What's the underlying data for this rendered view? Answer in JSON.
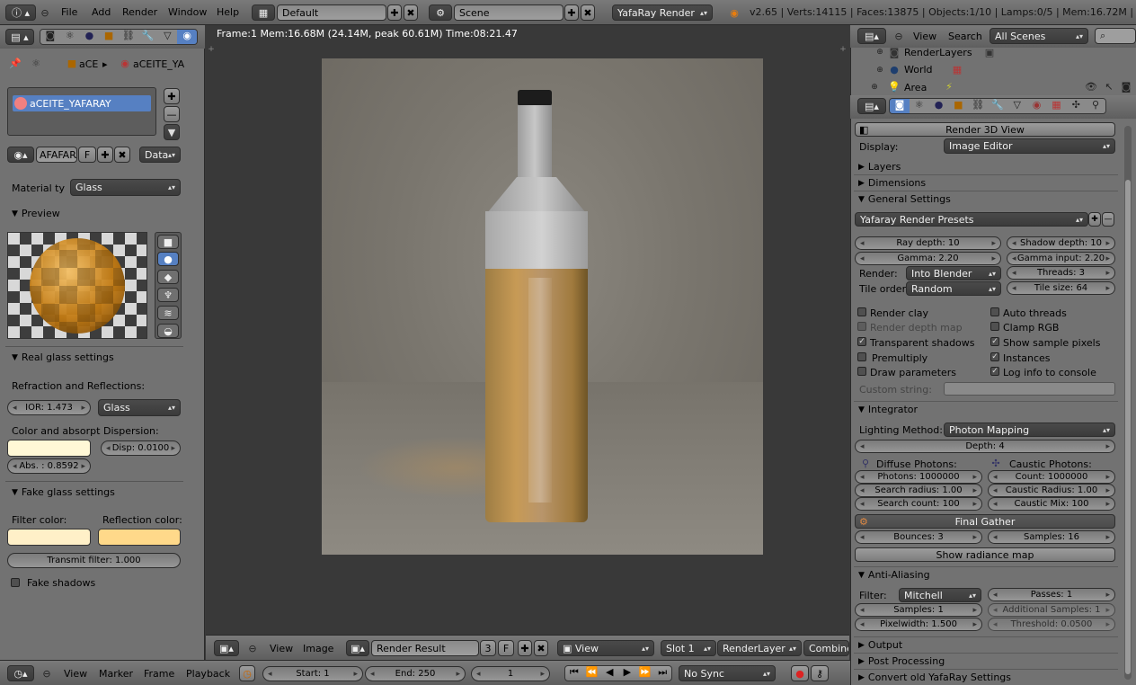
{
  "topbar": {
    "menus": [
      "File",
      "Add",
      "Render",
      "Window",
      "Help"
    ],
    "layout": "Default",
    "scene": "Scene",
    "engine": "YafaRay Render",
    "stats": "v2.65 | Verts:14115 | Faces:13875 | Objects:1/10 | Lamps:0/5 | Mem:16.72M | aC"
  },
  "left": {
    "breadcrumb_a": "aCE",
    "breadcrumb_b": "aCEITE_YA",
    "material_slot": "aCEITE_YAFARAY",
    "datablock": "AFAFARAY",
    "datablock_f": "F",
    "data_select": "Data",
    "material_type_label": "Material ty",
    "material_type": "Glass",
    "preview_title": "Preview",
    "real_glass_title": "Real glass settings",
    "refraction_label": "Refraction and Reflections:",
    "ior": "IOR: 1.473",
    "glass_mode": "Glass",
    "color_absorpt_label": "Color and absorpt",
    "dispersion_label": "Dispersion:",
    "disp": "Disp: 0.0100",
    "abs": "Abs. : 0.8592",
    "fake_glass_title": "Fake glass settings",
    "filter_color_label": "Filter color:",
    "reflection_color_label": "Reflection color:",
    "transmit_filter": "Transmit filter: 1.000",
    "fake_shadows": "Fake shadows"
  },
  "colors": {
    "absorb": "#fff8d6",
    "filter": "#fff0c8",
    "reflection": "#ffd98a"
  },
  "render": {
    "info": "Frame:1 Mem:16.68M (24.14M, peak 60.61M) Time:08:21.47"
  },
  "image_editor": {
    "view": "View",
    "image": "Image",
    "result": "Render Result",
    "slot_num": "3",
    "f": "F",
    "view_mode": "View",
    "slot": "Slot 1",
    "layer": "RenderLayer",
    "pass": "Combine"
  },
  "timeline": {
    "view": "View",
    "marker": "Marker",
    "frame": "Frame",
    "playback": "Playback",
    "start": "Start: 1",
    "end": "End: 250",
    "current": "1",
    "sync": "No Sync"
  },
  "outliner": {
    "view": "View",
    "search": "Search",
    "scope": "All Scenes",
    "rows": [
      "RenderLayers",
      "World",
      "Area"
    ]
  },
  "props": {
    "render_3d": "Render 3D View",
    "display_label": "Display:",
    "display": "Image Editor",
    "layers": "Layers",
    "dimensions": "Dimensions",
    "general": "General Settings",
    "presets": "Yafaray Render Presets",
    "ray_depth": "Ray depth: 10",
    "shadow_depth": "Shadow depth: 10",
    "gamma": "Gamma: 2.20",
    "gamma_input": "Gamma input: 2.20",
    "render_label": "Render:",
    "render_mode": "Into Blender",
    "threads": "Threads: 3",
    "tile_order_label": "Tile order",
    "tile_order": "Random",
    "tile_size": "Tile size: 64",
    "checks_left": [
      "Render clay",
      "Render depth map",
      "Transparent shadows",
      "Premultiply",
      "Draw parameters"
    ],
    "checks_right": [
      "Auto threads",
      "Clamp RGB",
      "Show sample pixels",
      "Instances",
      "Log info to console"
    ],
    "custom_string": "Custom string:",
    "integrator": "Integrator",
    "lighting_label": "Lighting Method:",
    "lighting": "Photon Mapping",
    "depth": "Depth: 4",
    "diffuse_photons": "Diffuse Photons:",
    "caustic_photons": "Caustic Photons:",
    "photons": "Photons: 1000000",
    "count": "Count: 1000000",
    "search_radius": "Search radius: 1.00",
    "caustic_radius": "Caustic Radius: 1.00",
    "search_count": "Search count: 100",
    "caustic_mix": "Caustic Mix: 100",
    "final_gather": "Final Gather",
    "bounces": "Bounces: 3",
    "samples16": "Samples: 16",
    "radiance": "Show radiance map",
    "anti": "Anti-Aliasing",
    "filter_label": "Filter:",
    "filter": "Mitchell",
    "passes": "Passes: 1",
    "samples1": "Samples: 1",
    "add_samples": "Additional Samples: 1",
    "pixelwidth": "Pixelwidth: 1.500",
    "threshold": "Threshold: 0.0500",
    "output": "Output",
    "post": "Post Processing",
    "convert": "Convert old YafaRay Settings"
  }
}
